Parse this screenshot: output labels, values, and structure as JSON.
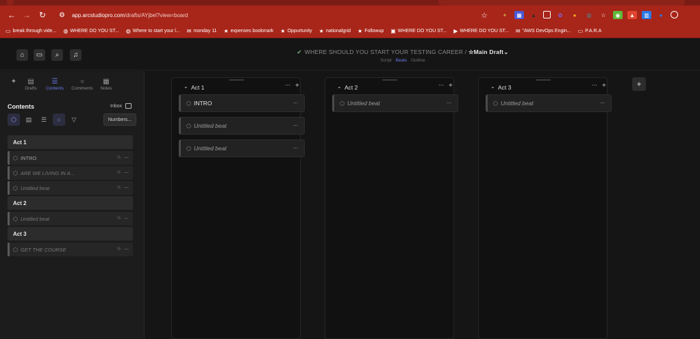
{
  "browser": {
    "url_domain": "app.arcstudiopro.com",
    "url_path": "/drafts/AYjbel?view=board",
    "bookmarks": [
      {
        "icon": "folder-icon",
        "label": "break through vide..."
      },
      {
        "icon": "globe-icon",
        "label": "WHERE DO YOU ST..."
      },
      {
        "icon": "globe-icon",
        "label": "Where to start your l..."
      },
      {
        "icon": "gmail-icon",
        "label": "monday 11"
      },
      {
        "icon": "star-icon",
        "label": "expenses bookmark"
      },
      {
        "icon": "star-icon",
        "label": "Oppurtunity"
      },
      {
        "icon": "star-icon",
        "label": "nationalgrid"
      },
      {
        "icon": "star-icon",
        "label": "Followup"
      },
      {
        "icon": "app-icon",
        "label": "WHERE DO YOU ST..."
      },
      {
        "icon": "video-icon",
        "label": "WHERE DO YOU ST..."
      },
      {
        "icon": "gmail-icon",
        "label": "\"AWS DevOps Engin..."
      },
      {
        "icon": "folder-icon",
        "label": "P.A.R.A"
      }
    ]
  },
  "header": {
    "doc_title": "WHERE SHOULD YOU START YOUR TESTING CAREER /",
    "draft_label": "Main Draft",
    "subtabs": [
      "Script",
      "Beats",
      "Outline"
    ],
    "active_subtab": "Beats"
  },
  "sidebar": {
    "tabs": [
      {
        "icon": "pin-icon",
        "label": ""
      },
      {
        "icon": "drafts-icon",
        "label": "Drafts"
      },
      {
        "icon": "contents-icon",
        "label": "Contents"
      },
      {
        "icon": "comments-icon",
        "label": "Comments"
      },
      {
        "icon": "notes-icon",
        "label": "Notes"
      }
    ],
    "section_title": "Contents",
    "inbox_label": "Inbox",
    "numbers_button": "Numbers...",
    "outline": [
      {
        "type": "act",
        "label": "Act 1"
      },
      {
        "type": "beat",
        "label": "INTRO",
        "frac": "½"
      },
      {
        "type": "beat",
        "label": "ARE WE LIVING IN A...",
        "frac": "½"
      },
      {
        "type": "beat",
        "label": "Untitled beat",
        "frac": "½"
      },
      {
        "type": "act",
        "label": "Act 2"
      },
      {
        "type": "beat",
        "label": "Untitled beat",
        "frac": "½"
      },
      {
        "type": "act",
        "label": "Act 3"
      },
      {
        "type": "beat",
        "label": "GET THE COURSE",
        "frac": "½"
      }
    ]
  },
  "board": {
    "columns": [
      {
        "title": "Act 1",
        "cards": [
          {
            "label": "INTRO",
            "named": true
          },
          {
            "label": "Untitled beat",
            "named": false
          },
          {
            "label": "Untitled beat",
            "named": false
          }
        ]
      },
      {
        "title": "Act 2",
        "cards": [
          {
            "label": "Untitled beat",
            "named": false
          }
        ]
      },
      {
        "title": "Act 3",
        "cards": [
          {
            "label": "Untitled beat",
            "named": false
          }
        ]
      }
    ]
  }
}
